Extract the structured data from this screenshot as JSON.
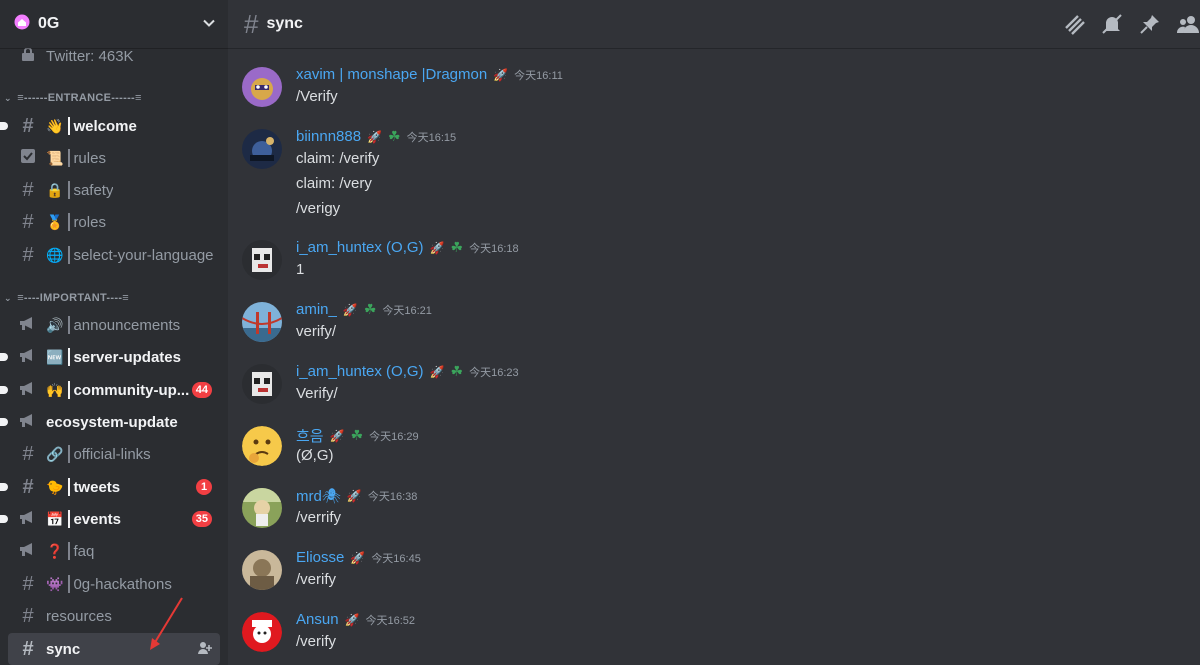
{
  "server": {
    "icon": "home-server-icon",
    "name": "0G"
  },
  "sidebar": {
    "top_channel": {
      "label": "Twitter: 463K"
    },
    "categories": [
      {
        "label": "≡------ENTRANCE------≡"
      },
      {
        "label": "≡----IMPORTANT----≡"
      }
    ],
    "channels": [
      {
        "name": "welcome",
        "emoji": "👋"
      },
      {
        "name": "rules",
        "emoji": "📜"
      },
      {
        "name": "safety",
        "emoji": "🔒"
      },
      {
        "name": "roles",
        "emoji": "🏅"
      },
      {
        "name": "select-your-language",
        "emoji": "🌐"
      },
      {
        "name": "announcements",
        "emoji": "🔊"
      },
      {
        "name": "server-updates",
        "emoji": "🆕"
      },
      {
        "name": "community-up...",
        "emoji": "🙌",
        "badge": "44"
      },
      {
        "name": "ecosystem-update"
      },
      {
        "name": "official-links",
        "emoji": "🔗"
      },
      {
        "name": "tweets",
        "emoji": "🐤",
        "badge": "1"
      },
      {
        "name": "events",
        "emoji": "📅",
        "badge": "35"
      },
      {
        "name": "faq",
        "emoji": "❓"
      },
      {
        "name": "0g-hackathons",
        "emoji": "👾"
      },
      {
        "name": "resources"
      },
      {
        "name": "sync"
      }
    ]
  },
  "header": {
    "channel": "sync"
  },
  "messages": [
    {
      "user": "xavim | monshape |Dragmon",
      "time": "今天16:11",
      "lines": [
        "/Verify"
      ]
    },
    {
      "user": "biinnn888",
      "time": "今天16:15",
      "lines": [
        "claim: /verify",
        "claim: /very",
        "/verigy"
      ]
    },
    {
      "user": "i_am_huntex (O,G)",
      "time": "今天16:18",
      "lines": [
        "1"
      ]
    },
    {
      "user": "amin_",
      "time": "今天16:21",
      "lines": [
        "verify/"
      ]
    },
    {
      "user": "i_am_huntex (O,G)",
      "time": "今天16:23",
      "lines": [
        "Verify/"
      ]
    },
    {
      "user": "흐음",
      "time": "今天16:29",
      "lines": [
        "(Ø,G)"
      ]
    },
    {
      "user": "mrd🕷",
      "time": "今天16:38",
      "lines": [
        "/verrify"
      ]
    },
    {
      "user": "Eliosse",
      "time": "今天16:45",
      "lines": [
        "/verify"
      ]
    },
    {
      "user": "Ansun",
      "time": "今天16:52",
      "lines": [
        "/verify"
      ]
    }
  ],
  "colors": {
    "accent_username": "#4aa7f2",
    "badge_red": "#f23f43",
    "boost": "#5ea8f0",
    "clover": "#3ba55c"
  }
}
